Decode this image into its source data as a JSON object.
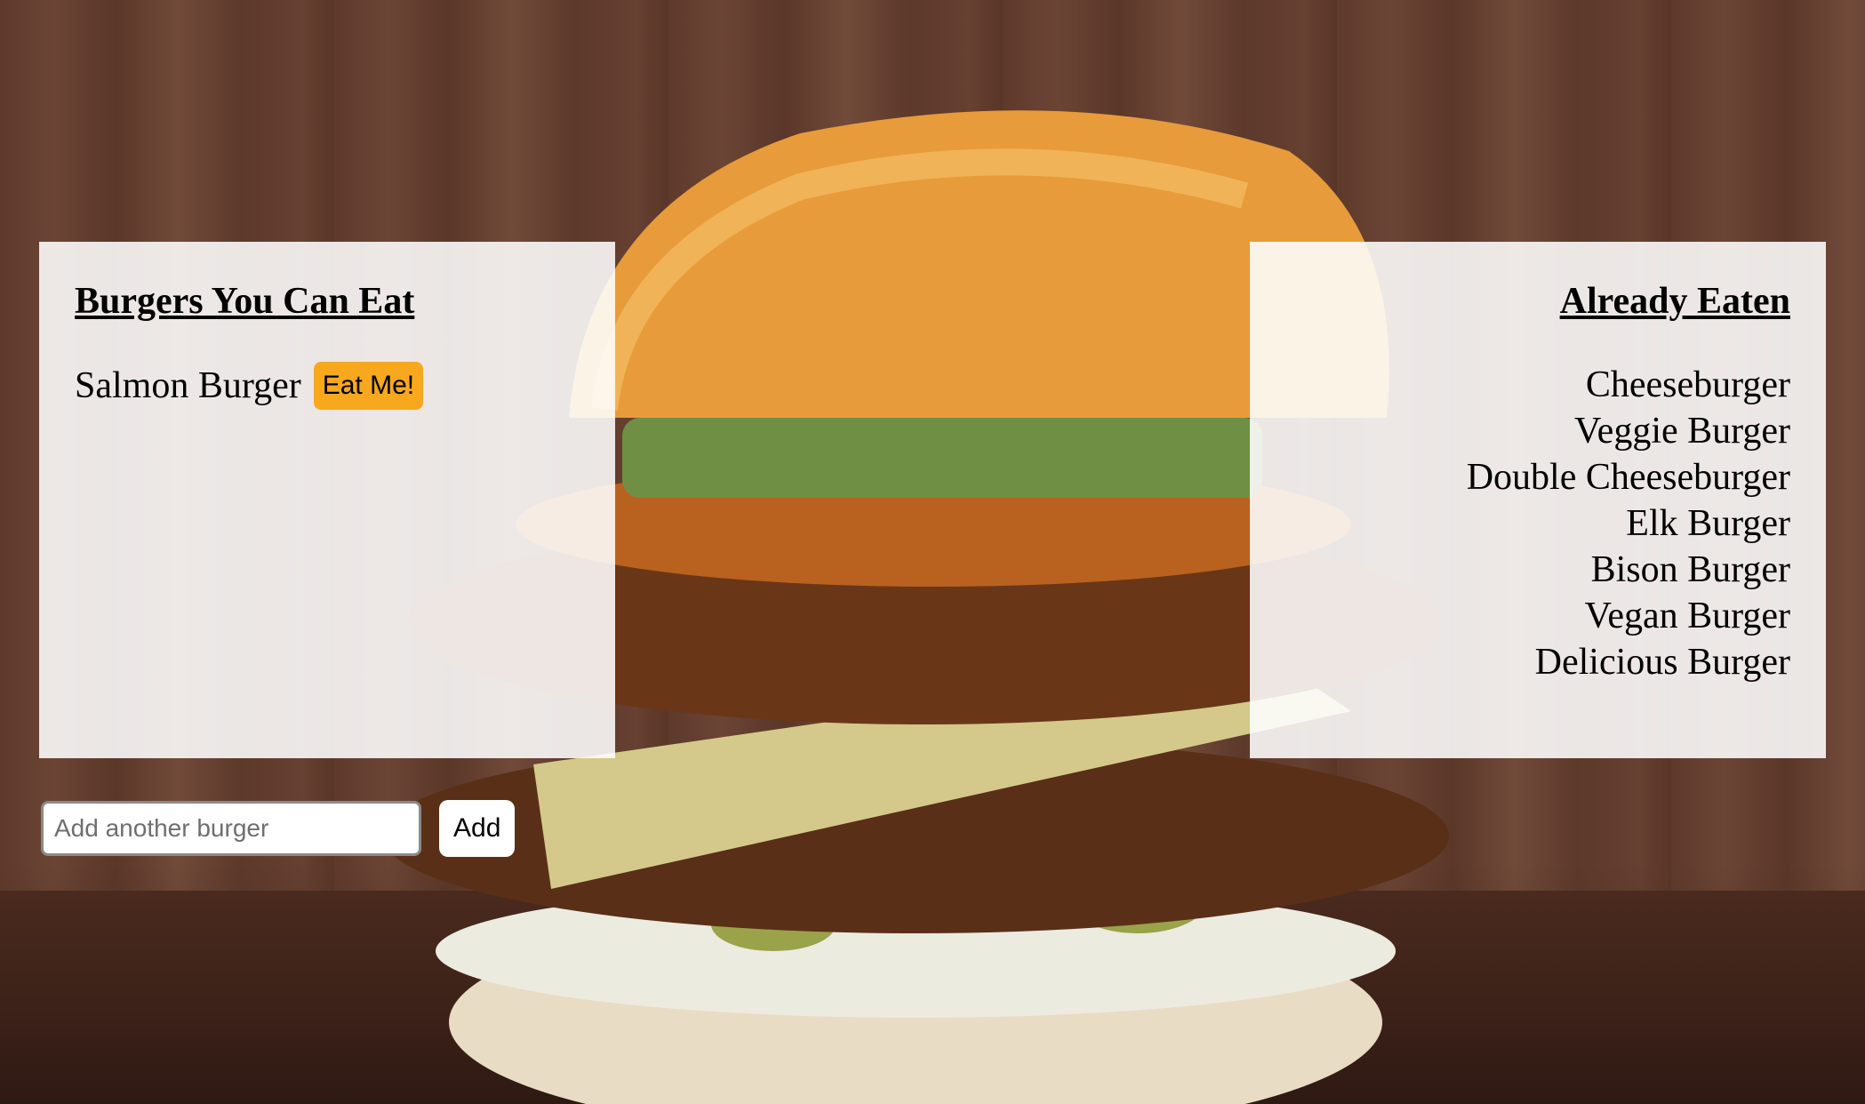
{
  "colors": {
    "eat_button": "#f7a81e",
    "panel_bg": "#ffffff",
    "wood_bg": "#5e3a2c"
  },
  "background": {
    "icon": "burger-photo"
  },
  "to_eat": {
    "title": "Burgers You Can Eat",
    "items": [
      {
        "name": "Salmon Burger",
        "button_label": "Eat Me!"
      }
    ]
  },
  "eaten": {
    "title": "Already Eaten",
    "items": [
      "Cheeseburger",
      "Veggie Burger",
      "Double Cheeseburger",
      "Elk Burger",
      "Bison Burger",
      "Vegan Burger",
      "Delicious Burger"
    ]
  },
  "add_form": {
    "input_value": "",
    "placeholder": "Add another burger",
    "button_label": "Add"
  }
}
